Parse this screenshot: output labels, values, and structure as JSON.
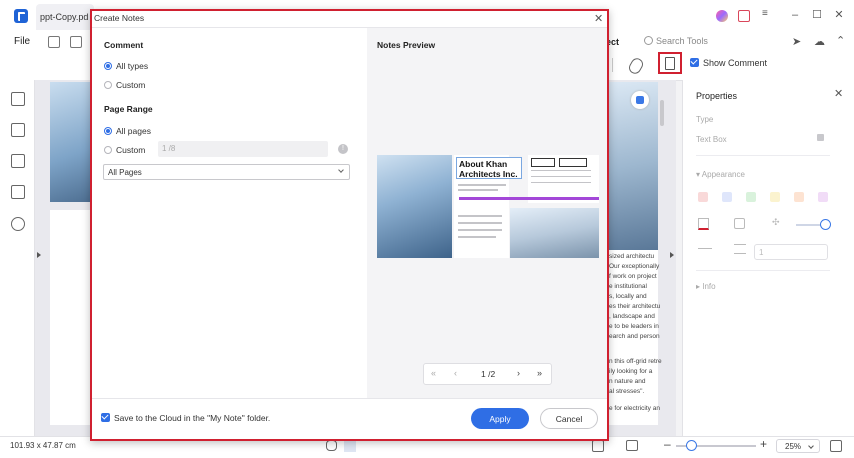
{
  "app": {
    "tab_title": "ppt-Copy.pd",
    "window_controls": [
      "–",
      "☐",
      "✕"
    ]
  },
  "menu": {
    "file": "File",
    "search_tools": "Search Tools",
    "partial_tab": "ect"
  },
  "toolbar": {
    "show_comment": "Show Comment"
  },
  "properties": {
    "title": "Properties",
    "type_label": "Type",
    "type_value": "Text Box",
    "appearance_label": "Appearance",
    "info_label": "Info",
    "line_width_value": "1",
    "swatch_colors": [
      "#f9d9d9",
      "#dfe6fb",
      "#d9f2dc",
      "#fbf3cf",
      "#fde3d2",
      "#f1dcf7"
    ]
  },
  "page_text_right": [
    "sized architectu",
    "Our exceptionally",
    "f work on project",
    "e institutional",
    "s, locally and",
    "es their architectu",
    ", landscape and",
    "e to be leaders in",
    "earch and person",
    "n this off-grid retre",
    "ily looking for a",
    "n nature and",
    "al stresses\".",
    "e for electricity an"
  ],
  "dialog": {
    "title": "Create Notes",
    "comment_section": "Comment",
    "comment_all": "All types",
    "comment_custom": "Custom",
    "page_range_section": "Page Range",
    "range_all": "All pages",
    "range_custom": "Custom",
    "range_custom_value": "1 /8",
    "pages_select": "All Pages",
    "preview_title": "Notes Preview",
    "preview_heading": "About Khan Architects Inc.",
    "pager_value": "1 /2",
    "save_cloud": "Save to the Cloud in the \"My Note\" folder.",
    "apply": "Apply",
    "cancel": "Cancel"
  },
  "status": {
    "dimensions": "101.93 x 47.87 cm",
    "zoom": "25%"
  }
}
